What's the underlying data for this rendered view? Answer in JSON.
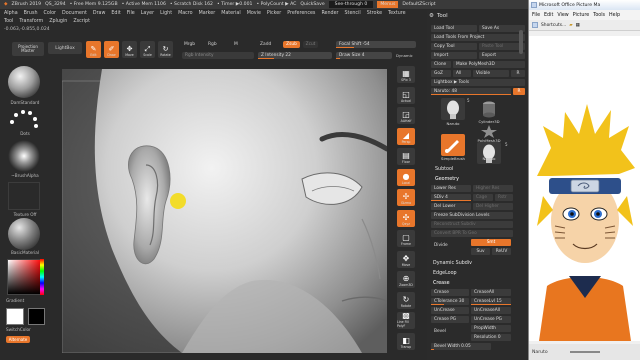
{
  "zbrush": {
    "title_bar": {
      "app": "ZBrush 2019",
      "file": "QS_3294",
      "free_mem": "• Free Mem 9.125GB",
      "active_mem": "• Active Mem 1106",
      "scratch_disk": "• Scratch Disk 162",
      "timer": "• Timer ▶0.001",
      "poly_count": "• PolyCount ▶ AC",
      "quicksave": "QuickSave",
      "see_through": "See-through  0",
      "menus": "Menus",
      "default_zscript": "DefaultZScript"
    },
    "menubar": [
      "Alpha",
      "Brush",
      "Color",
      "Document",
      "Draw",
      "Edit",
      "File",
      "Layer",
      "Light",
      "Macro",
      "Marker",
      "Material",
      "Movie",
      "Picker",
      "Preferences",
      "Render",
      "Stencil",
      "Stroke",
      "Texture",
      "Tool",
      "Transform",
      "Zplugin",
      "Zscript"
    ],
    "coords": "-0.063,-0.855,0.024",
    "shelf": {
      "projection_master_1": "Projection",
      "projection_master_2": "Master",
      "lightbox": "LightBox",
      "buttons": [
        {
          "label": "Edit",
          "glyph": "✎"
        },
        {
          "label": "Draw",
          "glyph": "✐"
        },
        {
          "label": "Move",
          "glyph": "✥"
        },
        {
          "label": "Scale",
          "glyph": "⤢"
        },
        {
          "label": "Rotate",
          "glyph": "↻"
        }
      ],
      "mrgb": "Mrgb",
      "rgb": "Rgb",
      "m": "M",
      "rgb_intensity": "Rgb Intensity",
      "zadd": "Zadd",
      "zsub": "Zsub",
      "zcut": "Zcut",
      "z_intensity": "Z Intensity 22",
      "focal_shift": "Focal Shift -54",
      "draw_size": "Draw Size  4",
      "dynamic": "Dynamic"
    },
    "left_tray": {
      "brush_name": "DamStandard",
      "stroke_name": "Dots",
      "alpha_name": "~BrushAlpha",
      "texture_name": "Texture Off",
      "material_name": "BasicMaterial",
      "gradient": "Gradient",
      "switch_color": "SwitchColor",
      "alternate": "Alternate"
    },
    "right_shelf": [
      {
        "label": "SPix 3",
        "glyph": "▦",
        "active": false
      },
      {
        "label": "Actual",
        "glyph": "◱",
        "active": false
      },
      {
        "label": "AAHalf",
        "glyph": "◲",
        "active": false
      },
      {
        "label": "Persp",
        "glyph": "◢",
        "active": true
      },
      {
        "label": "Floor",
        "glyph": "▤",
        "active": false
      },
      {
        "label": "Local",
        "glyph": "●",
        "active": true
      },
      {
        "label": "Gizmo",
        "glyph": "✢",
        "active": true
      },
      {
        "label": "Qxyz",
        "glyph": "✣",
        "active": true
      },
      {
        "label": "Frame",
        "glyph": "▢",
        "active": false
      },
      {
        "label": "Move",
        "glyph": "✥",
        "active": false
      },
      {
        "label": "Zoom3D",
        "glyph": "⊕",
        "active": false
      },
      {
        "label": "Rotate",
        "glyph": "↻",
        "active": false
      },
      {
        "label": "Line Fill PolyF",
        "glyph": "▩",
        "active": false
      },
      {
        "label": "Transp",
        "glyph": "◧",
        "active": false
      }
    ],
    "tool_palette": {
      "header": "Tool",
      "load_tool": "Load Tool",
      "save_as": "Save As",
      "load_from_project": "Load Tools From Project",
      "copy_tool": "Copy Tool",
      "paste_tool": "Paste Tool",
      "import": "Import",
      "export": "Export",
      "clone": "Clone",
      "make_polymesh": "Make PolyMesh3D",
      "goz": "GoZ",
      "all": "All",
      "visible": "Visible",
      "r": "R",
      "lightbox_tools": "Lightbox ▶ Tools",
      "tool_name_slider": "Naruto: 48",
      "tools": [
        {
          "name": "Naruto",
          "count": "5"
        },
        {
          "name": "Cylinder3D",
          "count": ""
        },
        {
          "name": "SimpleBrush",
          "count": ""
        },
        {
          "name": "PolyMesh3D",
          "count": ""
        },
        {
          "name": "Naruto",
          "count": "5"
        }
      ],
      "subtool": "Subtool",
      "geometry": "Geometry",
      "lower_res": "Lower Res",
      "higher_res": "Higher Res",
      "sdiv": "SDiv 4",
      "cage": "Cage",
      "rstr": "Rstr",
      "del_lower": "Del Lower",
      "del_higher": "Del Higher",
      "freeze_subdivision": "Freeze SubDivision Levels",
      "reconstruct_subdiv": "Reconstruct Subdiv",
      "convert_bpr": "Convert BPR To Geo",
      "divide": "Divide",
      "smt": "Smt",
      "suv": "Suv",
      "reuv": "ReUV",
      "dynamic_subdiv": "Dynamic Subdiv",
      "edgeloop": "EdgeLoop",
      "crease": "Crease",
      "crease_btn": "Crease",
      "crease_all": "CreaseAll",
      "ctolerance": "CTolerance 30",
      "crease_lvl": "CreaseLvl 15",
      "uncrease": "UnCrease",
      "uncrease_all": "UnCreaseAll",
      "crease_pg": "Crease PG",
      "uncrease_pg": "UnCrease PG",
      "bevel": "Bevel",
      "propwidth": "PropWidth",
      "resolution": "Resolution 0",
      "bevel_width": "Bevel Width 0.05"
    }
  },
  "picture_manager": {
    "title": "Microsoft Office Picture Ma",
    "menus": [
      "File",
      "Edit",
      "View",
      "Picture",
      "Tools",
      "Help"
    ],
    "toolbar_shortcuts": "Shortcuts...",
    "status_file": "Naruto",
    "colors": {
      "hair": "#f2c21b",
      "skin": "#f6d3a8",
      "headband": "#2d4f8a",
      "jacket": "#e8761f"
    }
  },
  "colors": {
    "accent": "#e8762b",
    "panel": "#2b2b2b",
    "button": "#3b3b3b"
  }
}
